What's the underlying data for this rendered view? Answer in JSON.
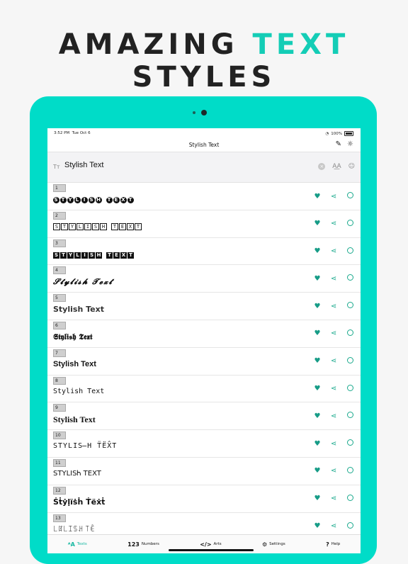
{
  "headline": {
    "part1": "AMAZING ",
    "part2": "TEXT",
    "part3": " STYLES"
  },
  "status": {
    "time": "3:52 PM",
    "date": "Tue Oct 6",
    "battery": "100%"
  },
  "nav": {
    "title": "Stylish Text",
    "edit_icon": "pencil-icon",
    "theme_icon": "lightbulb-icon"
  },
  "search": {
    "value": "Stylish Text",
    "left_icon": "Tт",
    "font_icon": "A͟A"
  },
  "rows": [
    {
      "num": "1",
      "text": "STYLISH TEXT"
    },
    {
      "num": "2",
      "text": "STYLISH TEXT"
    },
    {
      "num": "3",
      "text": "STYLISH TEXT"
    },
    {
      "num": "4",
      "text": "𝓢𝓽𝔂𝓵𝓲𝓼𝓱 𝓣𝓮𝔁𝓽"
    },
    {
      "num": "5",
      "text": "Stylish Text"
    },
    {
      "num": "6",
      "text": "𝕾𝖙𝖞𝖑𝖎𝖘𝖍 𝕿𝖊𝖝𝖙"
    },
    {
      "num": "7",
      "text": "Stylish Text"
    },
    {
      "num": "8",
      "text": "Stylish Text"
    },
    {
      "num": "9",
      "text": "Stylish Text"
    },
    {
      "num": "10",
      "text": "STYLIS̶H T̈ËX̂T"
    },
    {
      "num": "11",
      "text": "STYLISᏂ TEXT"
    },
    {
      "num": "12",
      "text": "Ṡṫẏḷïṡḣ Ṫëẋṫ"
    },
    {
      "num": "13",
      "text": "꒒ꍏ꒒ꀤꌗꃅ ꓄ꍟ"
    }
  ],
  "tabs": [
    {
      "label": "Texts",
      "icon": "ᴬA"
    },
    {
      "label": "Numbers",
      "icon": "123"
    },
    {
      "label": "Arts",
      "icon": "</>"
    },
    {
      "label": "Settings",
      "icon": "⚙"
    },
    {
      "label": "Help",
      "icon": "?"
    }
  ],
  "colors": {
    "accent": "#14cdb6",
    "device": "#00dcc8",
    "icon": "#19a98c"
  }
}
